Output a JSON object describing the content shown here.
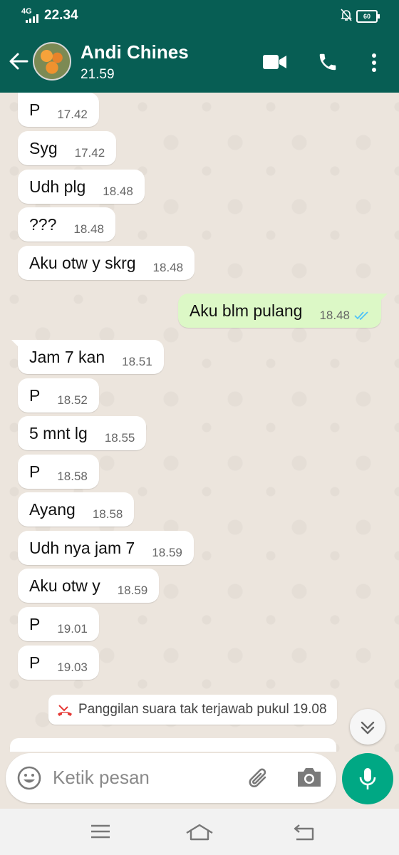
{
  "status_bar": {
    "network": "4G",
    "time": "22.34",
    "battery": "60"
  },
  "header": {
    "contact_name": "Andi Chines",
    "last_seen": "21.59"
  },
  "messages": [
    {
      "text": "P",
      "time": "17.42"
    },
    {
      "text": "Syg",
      "time": "17.42"
    },
    {
      "text": "Udh plg",
      "time": "18.48"
    },
    {
      "text": "???",
      "time": "18.48"
    },
    {
      "text": "Aku otw y skrg",
      "time": "18.48"
    },
    {
      "text": "Aku blm pulang",
      "time": "18.48",
      "status": "read"
    },
    {
      "text": "Jam 7 kan",
      "time": "18.51"
    },
    {
      "text": "P",
      "time": "18.52"
    },
    {
      "text": "5 mnt lg",
      "time": "18.55"
    },
    {
      "text": "P",
      "time": "18.58"
    },
    {
      "text": "Ayang",
      "time": "18.58"
    },
    {
      "text": "Udh nya jam 7",
      "time": "18.59"
    },
    {
      "text": "Aku otw y",
      "time": "18.59"
    },
    {
      "text": "P",
      "time": "19.01"
    },
    {
      "text": "P",
      "time": "19.03"
    }
  ],
  "missed_call": {
    "text": "Panggilan suara tak terjawab pukul 19.08"
  },
  "composer": {
    "placeholder": "Ketik pesan"
  },
  "colors": {
    "header": "#075e54",
    "outgoing_bubble": "#dcf8c6",
    "incoming_bubble": "#ffffff",
    "mic_button": "#00a884",
    "read_ticks": "#4fc3f7",
    "missed_call_icon": "#e53935"
  }
}
